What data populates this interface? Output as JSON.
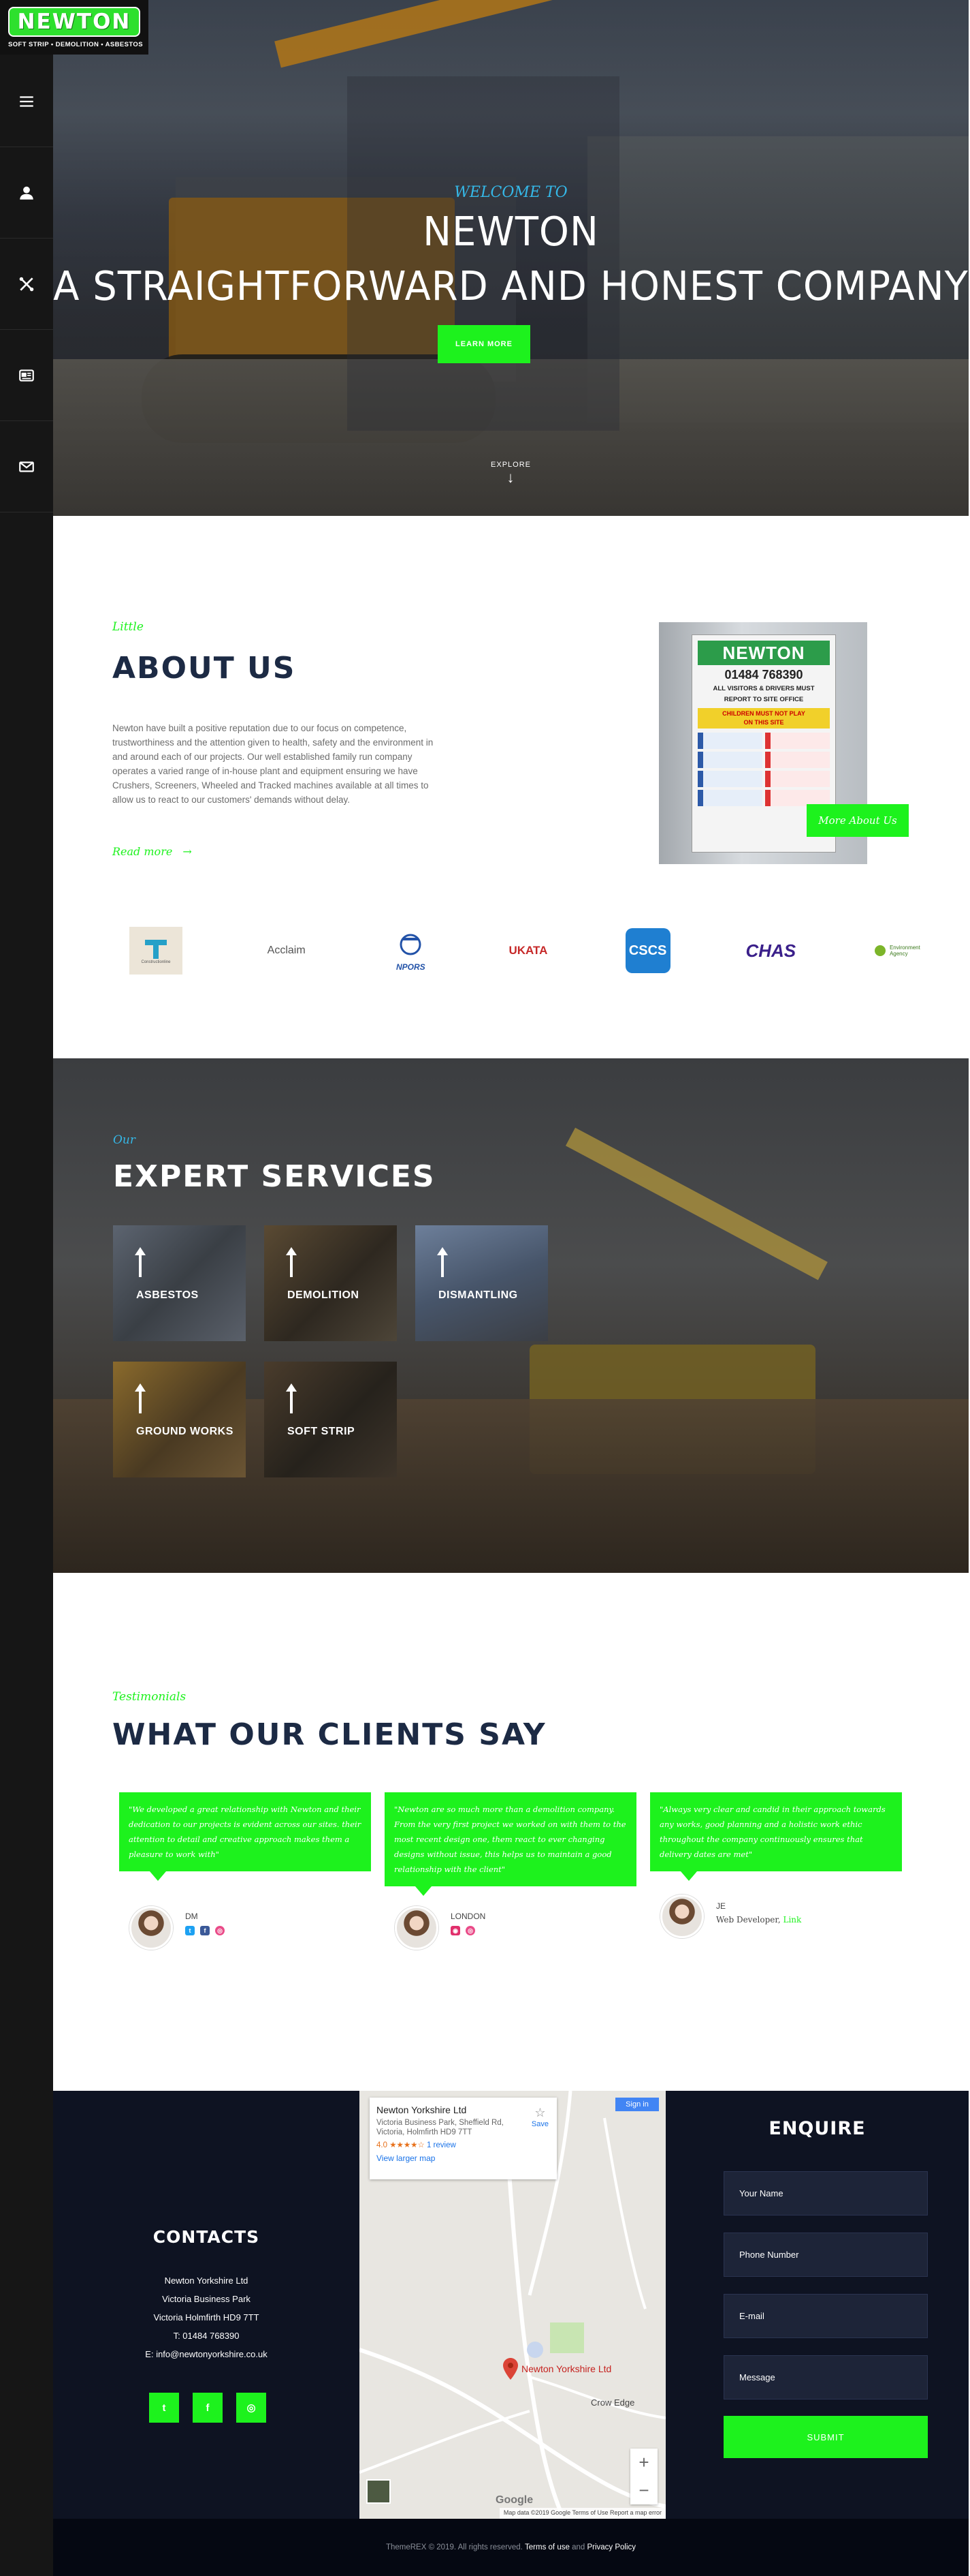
{
  "brand": {
    "logo_text": "NEWTON",
    "tagline": "SOFT STRIP • DEMOLITION • ASBESTOS",
    "accent": "#1df21d",
    "accent_blue": "#35b8e8",
    "navy": "#1c2a44"
  },
  "sidebar": {
    "icons": [
      "menu-icon",
      "user-icon",
      "tools-icon",
      "news-icon",
      "mail-icon"
    ]
  },
  "hero": {
    "welcome": "WELCOME TO",
    "title_line1": "NEWTON",
    "title_line2": "A STRAIGHTFORWARD AND HONEST COMPANY",
    "button": "LEARN MORE",
    "explore": "EXPLORE"
  },
  "about": {
    "small": "Little",
    "title": "ABOUT US",
    "text": "Newton have built a positive reputation due to our focus on competence, trustworthiness and the attention given to health, safety and the environment in and around each of our projects. Our well established family run company operates a varied range of in-house plant and equipment ensuring we have Crushers, Screeners, Wheeled and Tracked machines available at all times to allow us to react to our customers' demands without delay.",
    "read_more": "Read more",
    "more_button": "More About Us",
    "sign": {
      "name": "NEWTON",
      "phone": "01484 768390",
      "line1": "ALL VISITORS & DRIVERS MUST",
      "line2": "REPORT TO SITE OFFICE",
      "warning1": "CHILDREN MUST NOT PLAY",
      "warning2": "ON THIS SITE"
    }
  },
  "partners": [
    {
      "name": "Constructionline"
    },
    {
      "name": "Acclaim"
    },
    {
      "name": "NPORS"
    },
    {
      "name": "UKATA"
    },
    {
      "name": "CSCS"
    },
    {
      "name": "CHAS"
    },
    {
      "name": "Environment Agency"
    }
  ],
  "services": {
    "small": "Our",
    "title": "EXPERT SERVICES",
    "items": [
      {
        "label": "ASBESTOS"
      },
      {
        "label": "DEMOLITION"
      },
      {
        "label": "DISMANTLING"
      },
      {
        "label": "GROUND WORKS"
      },
      {
        "label": "SOFT STRIP"
      }
    ]
  },
  "testimonials": {
    "small": "Testimonials",
    "title": "WHAT OUR CLIENTS SAY",
    "items": [
      {
        "quote": "\"We developed a great relationship with Newton and their dedication to our projects is evident across our sites. their attention to detail and creative approach makes them a pleasure to work with\"",
        "name": "DM"
      },
      {
        "quote": "\"Newton are so much more than a demolition company. From the very first project we worked on with them to the most recent design one, them react to ever changing designs without issue, this helps us to maintain a good relationship with the client\"",
        "name": "LONDON"
      },
      {
        "quote": "\"Always very clear and candid in their approach towards any works, good planning and a holistic work ethic throughout the company continuously ensures that delivery dates are met\"",
        "name": "JE",
        "role": "Web Developer,",
        "link": "Link"
      }
    ]
  },
  "contacts": {
    "title": "CONTACTS",
    "company": "Newton Yorkshire Ltd",
    "address1": "Victoria Business Park",
    "address2": "Victoria Holmfirth HD9 7TT",
    "phone": "T: 01484 768390",
    "email": "E: info@newtonyorkshire.co.uk"
  },
  "map": {
    "place": "Newton Yorkshire Ltd",
    "address": "Victoria Business Park, Sheffield Rd, Victoria, Holmfirth HD9 7TT",
    "rating": "4.0",
    "stars": "★★★★☆",
    "reviews": "1 review",
    "larger": "View larger map",
    "save": "Save",
    "signin": "Sign in",
    "pin_label": "Newton Yorkshire Ltd",
    "crow_edge": "Crow Edge",
    "google": "Google",
    "footer": "Map data ©2019 Google   Terms of Use   Report a map error"
  },
  "enquire": {
    "title": "ENQUIRE",
    "name": "Your Name",
    "phone": "Phone Number",
    "email": "E-mail",
    "message": "Message",
    "submit": "SUBMIT"
  },
  "footer": {
    "copy": "ThemeREX © 2019. All rights reserved.",
    "terms": "Terms of use",
    "and": "and",
    "privacy": "Privacy Policy"
  }
}
